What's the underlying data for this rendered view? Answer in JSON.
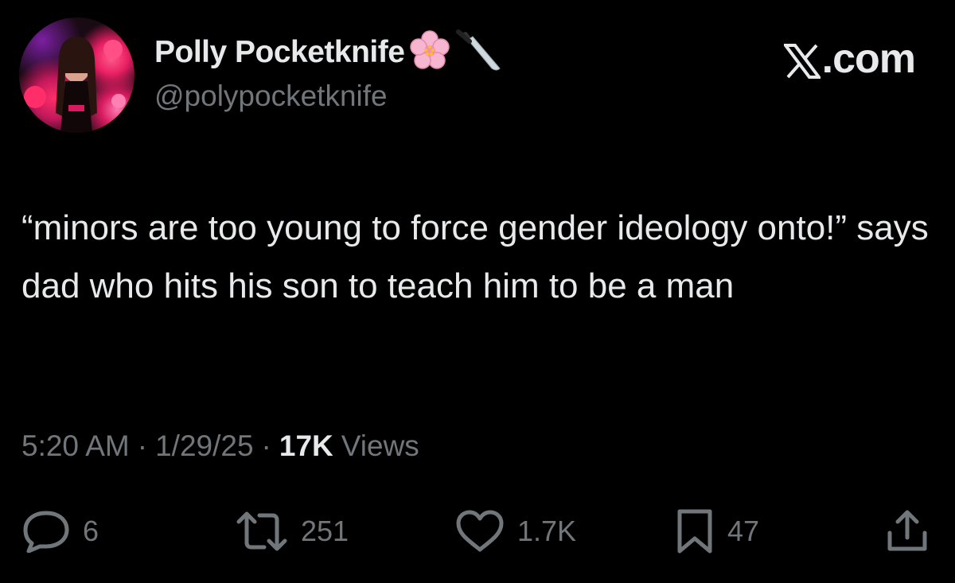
{
  "author": {
    "display_name": "Polly Pocketknife",
    "name_emojis": [
      "cherry-blossom-icon",
      "knife-icon"
    ],
    "handle": "@polypocketknife",
    "avatar": "profile-photo"
  },
  "brand": {
    "label": ".com",
    "logo": "x-logo-icon"
  },
  "tweet": {
    "text": "“minors are too young to force gender ideology onto!” says dad who hits his son to teach him to be a man",
    "time": "5:20 AM",
    "date": "1/29/25",
    "separator": "·",
    "views_count": "17K",
    "views_label": "Views"
  },
  "actions": {
    "replies": "6",
    "reposts": "251",
    "likes": "1.7K",
    "bookmarks": "47"
  },
  "colors": {
    "background": "#000000",
    "primary_text": "#e7e9ea",
    "secondary_text": "#71767b"
  }
}
